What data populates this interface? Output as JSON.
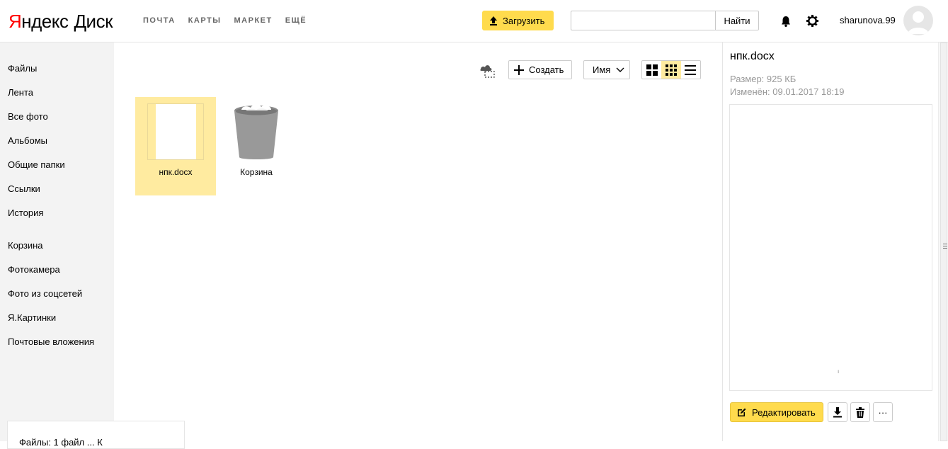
{
  "header": {
    "logo_ya": "Я",
    "logo_rest": "ндекс",
    "logo_disk": "Диск",
    "nav": [
      "ПОЧТА",
      "КАРТЫ",
      "МАРКЕТ",
      "ЕЩЁ"
    ],
    "upload_label": "Загрузить",
    "search_value": "",
    "search_button": "Найти",
    "username": "sharunova.99"
  },
  "sidebar": {
    "items": [
      "Файлы",
      "Лента",
      "Все фото",
      "Альбомы",
      "Общие папки",
      "Ссылки",
      "История"
    ],
    "items2": [
      "Корзина",
      "Фотокамера",
      "Фото из соцсетей",
      "Я.Картинки",
      "Почтовые вложения"
    ],
    "bottom_text": "Файлы: 1 файл ... К"
  },
  "toolbar": {
    "create_label": "Создать",
    "sort_label": "Имя"
  },
  "files": [
    {
      "name": "нпк.docx",
      "selected": true
    },
    {
      "name": "Корзина",
      "selected": false
    }
  ],
  "details": {
    "title": "нпк.docx",
    "size": "Размер: 925 КБ",
    "modified": "Изменён: 09.01.2017 18:19",
    "preview_mark": "ı",
    "edit_label": "Редактировать",
    "more_label": "···"
  },
  "colors": {
    "accent": "#ffdb4d",
    "selection": "#ffeba0",
    "logo_red": "#ff0000"
  }
}
